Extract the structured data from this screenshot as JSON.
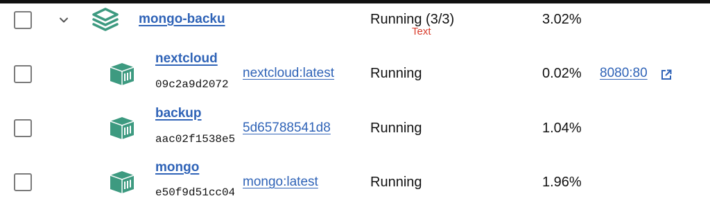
{
  "stack": {
    "name": "mongo-backu",
    "status": "Running (3/3)",
    "cpu": "3.02%",
    "annotation": "Text"
  },
  "containers": [
    {
      "name": "nextcloud",
      "id": "09c2a9d2072",
      "image": "nextcloud:latest",
      "status": "Running",
      "cpu": "0.02%",
      "port": "8080:80"
    },
    {
      "name": "backup",
      "id": "aac02f1538e5",
      "image": "5d65788541d8",
      "status": "Running",
      "cpu": "1.04%"
    },
    {
      "name": "mongo",
      "id": "e50f9d51cc04",
      "image": "mongo:latest",
      "status": "Running",
      "cpu": "1.96%"
    }
  ],
  "colors": {
    "link": "#2f63b7",
    "icon": "#3d9a80",
    "checkbox_border": "#7a7a7a",
    "annotation": "#d83a2a"
  },
  "icons": {
    "stack": "layers-icon",
    "container": "container-icon",
    "expand": "chevron-down-icon",
    "external": "external-link-icon"
  }
}
